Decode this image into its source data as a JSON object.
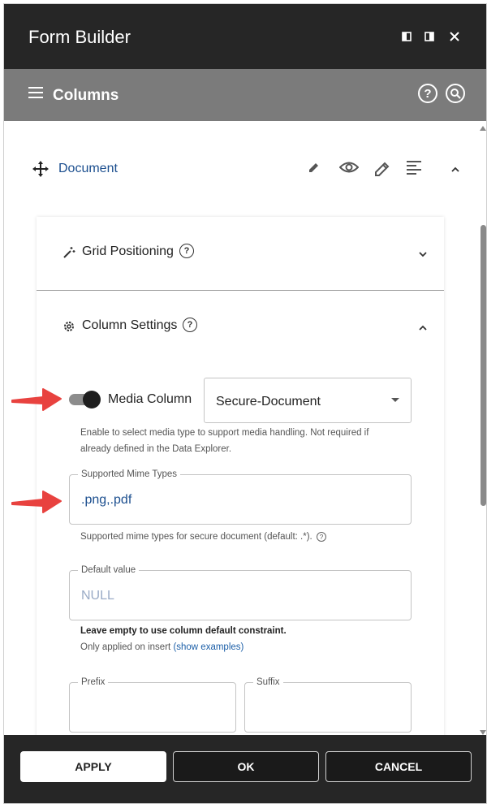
{
  "window": {
    "title": "Form Builder"
  },
  "header": {
    "title": "Columns",
    "help_glyph": "?"
  },
  "document": {
    "name": "Document"
  },
  "sections": {
    "grid": {
      "title": "Grid Positioning",
      "help_glyph": "?"
    },
    "column": {
      "title": "Column Settings",
      "help_glyph": "?"
    }
  },
  "media": {
    "toggle_label": "Media Column",
    "toggle_on": true,
    "select_value": "Secure-Document",
    "helper_line1": "Enable to select media type to support media handling. Not required if",
    "helper_line2": "already defined in the Data Explorer."
  },
  "mime": {
    "label": "Supported Mime Types",
    "value": ".png,.pdf",
    "helper": "Supported mime types for secure document (default: .*)."
  },
  "default_value": {
    "label": "Default value",
    "placeholder": "NULL",
    "note_bold": "Leave empty to use column default constraint.",
    "note_prefix": "Only applied on insert ",
    "note_link": "(show examples)"
  },
  "prefix": {
    "label": "Prefix"
  },
  "suffix": {
    "label": "Suffix"
  },
  "footer": {
    "apply": "APPLY",
    "ok": "OK",
    "cancel": "CANCEL"
  },
  "colors": {
    "title_bar": "#262626",
    "header_bar": "#7b7b7b",
    "link": "#1c5fa8",
    "annotation_arrow": "#e8423f"
  }
}
